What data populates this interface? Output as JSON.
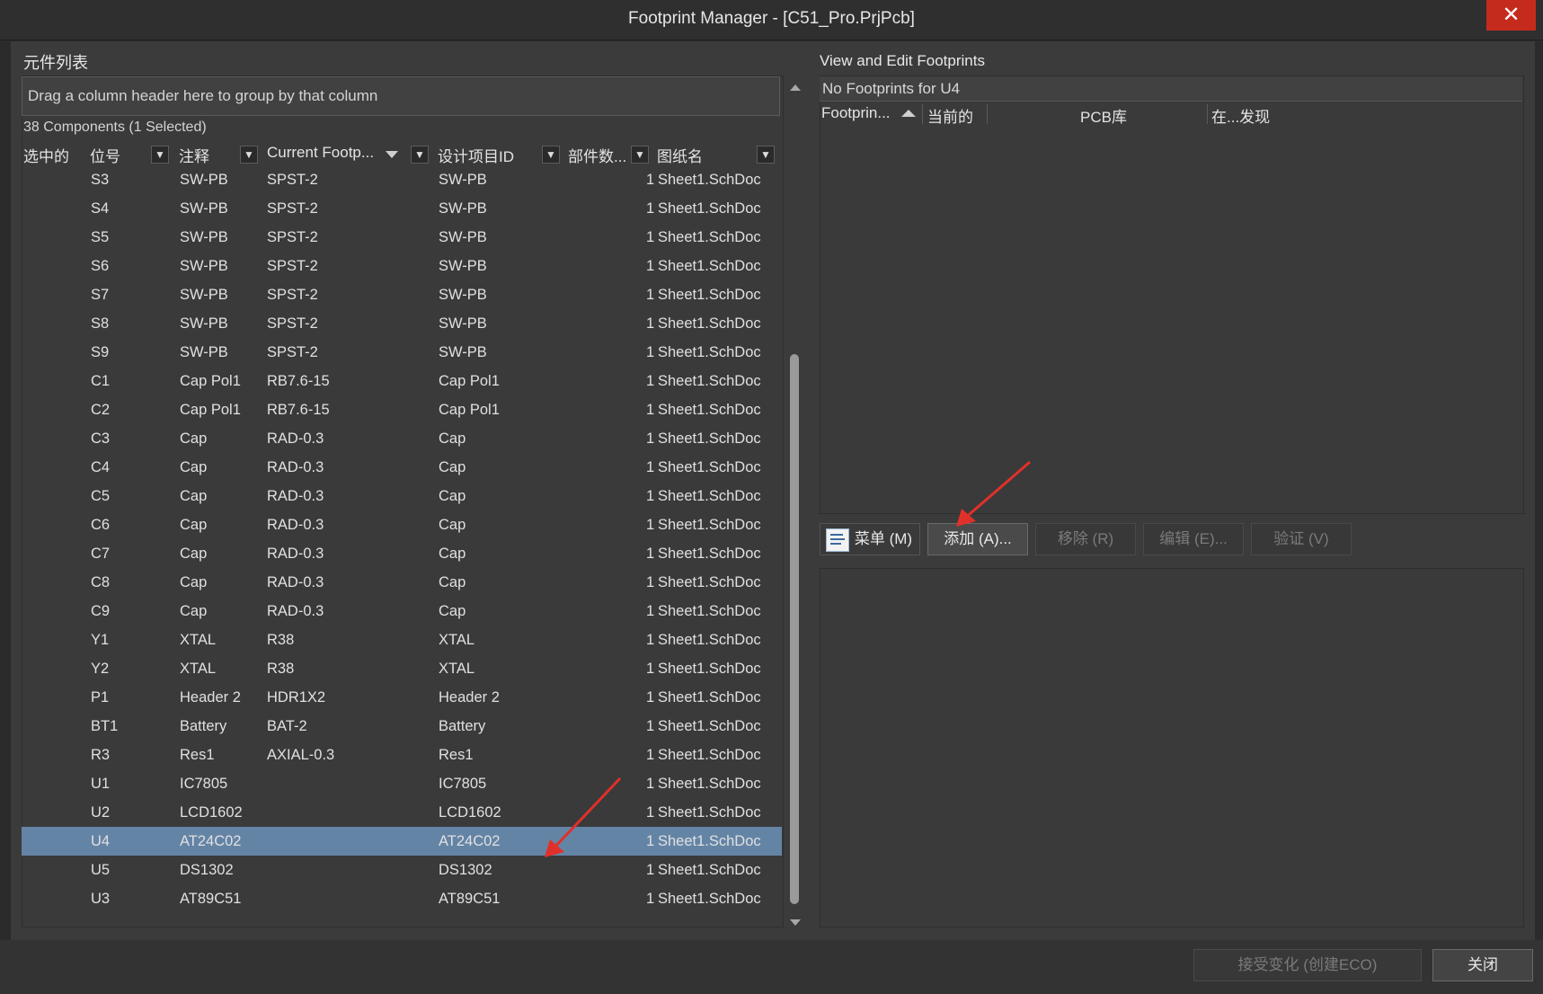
{
  "window": {
    "title": "Footprint Manager - [C51_Pro.PrjPcb]",
    "close_glyph": "✕"
  },
  "left": {
    "section_title": "元件列表",
    "group_hint": "Drag a column header here to group by that column",
    "count_text": "38 Components (1 Selected)",
    "columns": [
      "选中的",
      "位号",
      "注释",
      "Current Footp...",
      "设计项目ID",
      "部件数...",
      "图纸名"
    ],
    "rows": [
      {
        "designator": "S3",
        "comment": "SW-PB",
        "footprint": "SPST-2",
        "design_id": "SW-PB",
        "parts": "1",
        "sheet": "Sheet1.SchDoc"
      },
      {
        "designator": "S4",
        "comment": "SW-PB",
        "footprint": "SPST-2",
        "design_id": "SW-PB",
        "parts": "1",
        "sheet": "Sheet1.SchDoc"
      },
      {
        "designator": "S5",
        "comment": "SW-PB",
        "footprint": "SPST-2",
        "design_id": "SW-PB",
        "parts": "1",
        "sheet": "Sheet1.SchDoc"
      },
      {
        "designator": "S6",
        "comment": "SW-PB",
        "footprint": "SPST-2",
        "design_id": "SW-PB",
        "parts": "1",
        "sheet": "Sheet1.SchDoc"
      },
      {
        "designator": "S7",
        "comment": "SW-PB",
        "footprint": "SPST-2",
        "design_id": "SW-PB",
        "parts": "1",
        "sheet": "Sheet1.SchDoc"
      },
      {
        "designator": "S8",
        "comment": "SW-PB",
        "footprint": "SPST-2",
        "design_id": "SW-PB",
        "parts": "1",
        "sheet": "Sheet1.SchDoc"
      },
      {
        "designator": "S9",
        "comment": "SW-PB",
        "footprint": "SPST-2",
        "design_id": "SW-PB",
        "parts": "1",
        "sheet": "Sheet1.SchDoc"
      },
      {
        "designator": "C1",
        "comment": "Cap Pol1",
        "footprint": "RB7.6-15",
        "design_id": "Cap Pol1",
        "parts": "1",
        "sheet": "Sheet1.SchDoc"
      },
      {
        "designator": "C2",
        "comment": "Cap Pol1",
        "footprint": "RB7.6-15",
        "design_id": "Cap Pol1",
        "parts": "1",
        "sheet": "Sheet1.SchDoc"
      },
      {
        "designator": "C3",
        "comment": "Cap",
        "footprint": "RAD-0.3",
        "design_id": "Cap",
        "parts": "1",
        "sheet": "Sheet1.SchDoc"
      },
      {
        "designator": "C4",
        "comment": "Cap",
        "footprint": "RAD-0.3",
        "design_id": "Cap",
        "parts": "1",
        "sheet": "Sheet1.SchDoc"
      },
      {
        "designator": "C5",
        "comment": "Cap",
        "footprint": "RAD-0.3",
        "design_id": "Cap",
        "parts": "1",
        "sheet": "Sheet1.SchDoc"
      },
      {
        "designator": "C6",
        "comment": "Cap",
        "footprint": "RAD-0.3",
        "design_id": "Cap",
        "parts": "1",
        "sheet": "Sheet1.SchDoc"
      },
      {
        "designator": "C7",
        "comment": "Cap",
        "footprint": "RAD-0.3",
        "design_id": "Cap",
        "parts": "1",
        "sheet": "Sheet1.SchDoc"
      },
      {
        "designator": "C8",
        "comment": "Cap",
        "footprint": "RAD-0.3",
        "design_id": "Cap",
        "parts": "1",
        "sheet": "Sheet1.SchDoc"
      },
      {
        "designator": "C9",
        "comment": "Cap",
        "footprint": "RAD-0.3",
        "design_id": "Cap",
        "parts": "1",
        "sheet": "Sheet1.SchDoc"
      },
      {
        "designator": "Y1",
        "comment": "XTAL",
        "footprint": "R38",
        "design_id": "XTAL",
        "parts": "1",
        "sheet": "Sheet1.SchDoc"
      },
      {
        "designator": "Y2",
        "comment": "XTAL",
        "footprint": "R38",
        "design_id": "XTAL",
        "parts": "1",
        "sheet": "Sheet1.SchDoc"
      },
      {
        "designator": "P1",
        "comment": "Header 2",
        "footprint": "HDR1X2",
        "design_id": "Header 2",
        "parts": "1",
        "sheet": "Sheet1.SchDoc"
      },
      {
        "designator": "BT1",
        "comment": "Battery",
        "footprint": "BAT-2",
        "design_id": "Battery",
        "parts": "1",
        "sheet": "Sheet1.SchDoc"
      },
      {
        "designator": "R3",
        "comment": "Res1",
        "footprint": "AXIAL-0.3",
        "design_id": "Res1",
        "parts": "1",
        "sheet": "Sheet1.SchDoc"
      },
      {
        "designator": "U1",
        "comment": "IC7805",
        "footprint": "",
        "design_id": "IC7805",
        "parts": "1",
        "sheet": "Sheet1.SchDoc"
      },
      {
        "designator": "U2",
        "comment": "LCD1602",
        "footprint": "",
        "design_id": "LCD1602",
        "parts": "1",
        "sheet": "Sheet1.SchDoc"
      },
      {
        "designator": "U4",
        "comment": "AT24C02",
        "footprint": "",
        "design_id": "AT24C02",
        "parts": "1",
        "sheet": "Sheet1.SchDoc",
        "selected": true
      },
      {
        "designator": "U5",
        "comment": "DS1302",
        "footprint": "",
        "design_id": "DS1302",
        "parts": "1",
        "sheet": "Sheet1.SchDoc"
      },
      {
        "designator": "U3",
        "comment": "AT89C51",
        "footprint": "",
        "design_id": "AT89C51",
        "parts": "1",
        "sheet": "Sheet1.SchDoc"
      }
    ]
  },
  "right": {
    "section_title": "View and Edit Footprints",
    "no_footprints": "No Footprints for U4",
    "columns": [
      "Footprin...",
      "当前的",
      "PCB库",
      "在...发现"
    ],
    "buttons": {
      "menu": "菜单 (M)",
      "add": "添加 (A)...",
      "remove": "移除 (R)",
      "edit": "编辑 (E)...",
      "validate": "验证 (V)"
    }
  },
  "footer": {
    "accept": "接受变化 (创建ECO)",
    "close": "关闭"
  },
  "colors": {
    "selection": "#6484a6",
    "arrow": "#e0302a",
    "close_button": "#c42b1c"
  }
}
